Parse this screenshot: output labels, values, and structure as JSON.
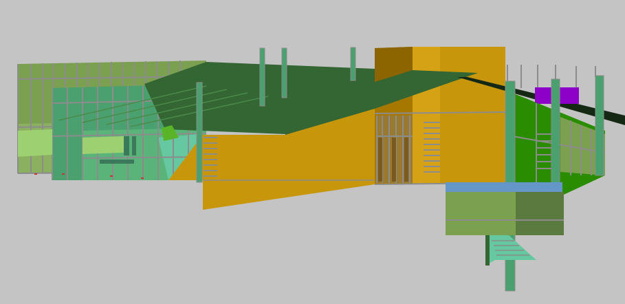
{
  "scene": {
    "background": "#c4c4c4",
    "palette": {
      "roof": "#336633",
      "ochre": "#c8960a",
      "ochre_dark": "#8c6400",
      "olive": "#7ba050",
      "teal": "#4aa06e",
      "mint": "#66c8a0",
      "bright_green": "#2a8c00",
      "purple": "#8c00c8",
      "blue": "#6496c8",
      "dark_green": "#142814",
      "mullion": "#8c8c8c"
    }
  }
}
